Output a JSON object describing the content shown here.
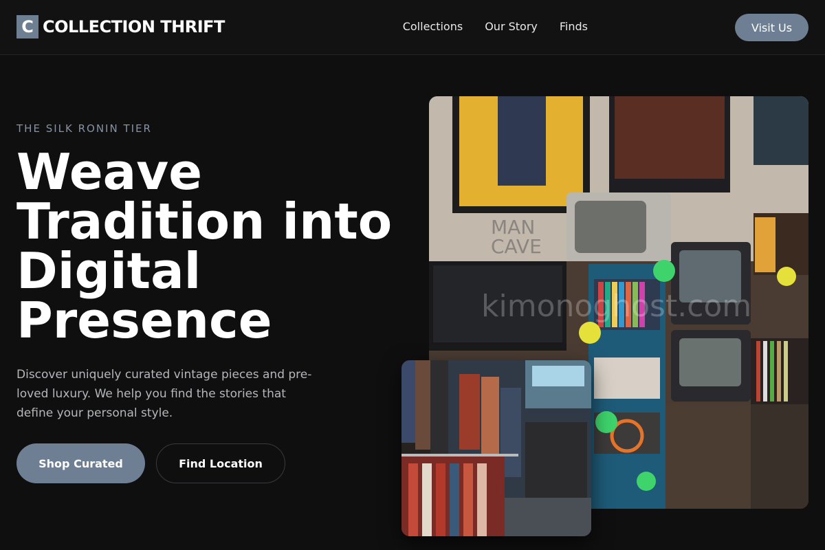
{
  "brand": {
    "mark": "C",
    "name": "COLLECTION THRIFT"
  },
  "nav": {
    "links": [
      "Collections",
      "Our Story",
      "Finds"
    ],
    "cta": "Visit Us"
  },
  "hero": {
    "eyebrow": "THE SILK RONIN TIER",
    "headline_lines": [
      "Weave",
      "Tradition into",
      "Digital",
      "Presence"
    ],
    "description": "Discover uniquely curated vintage pieces and pre-loved luxury. We help you find the stories that define your personal style.",
    "primary_button": "Shop Curated",
    "secondary_button": "Find Location"
  },
  "images": {
    "watermark": "kimonoghost.com"
  },
  "colors": {
    "accent": "#6f7f93",
    "background": "#0f0f10"
  }
}
